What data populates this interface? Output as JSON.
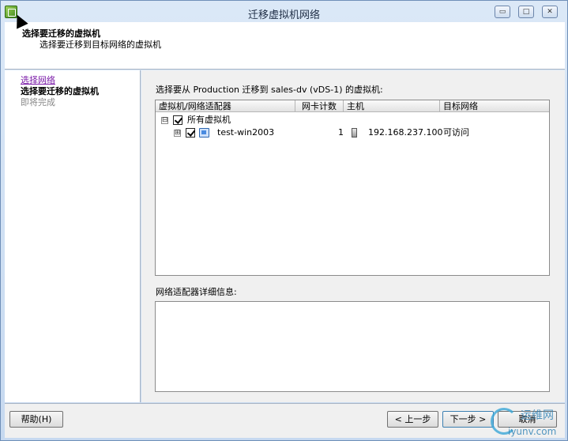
{
  "window": {
    "title": "迁移虚拟机网络",
    "controls": {
      "minimize": "▭",
      "maximize": "□",
      "close": "✕"
    }
  },
  "header": {
    "title": "选择要迁移的虚拟机",
    "subtitle": "选择要迁移到目标网络的虚拟机"
  },
  "nav": {
    "items": [
      {
        "label": "选择网络",
        "state": "link"
      },
      {
        "label": "选择要迁移的虚拟机",
        "state": "current"
      },
      {
        "label": "即将完成",
        "state": "pending"
      }
    ]
  },
  "main": {
    "prompt": "选择要从 Production 迁移到 sales-dv (vDS-1) 的虚拟机:",
    "table": {
      "columns": [
        "虚拟机/网络适配器",
        "网卡计数",
        "主机",
        "目标网络"
      ],
      "group": {
        "expander": "⊟",
        "label": "所有虚拟机",
        "checked": true
      },
      "rows": [
        {
          "expander": "⊞",
          "checked": true,
          "icon": "vm-icon",
          "name": "test-win2003",
          "nic_count": "1",
          "host_icon": "host-icon",
          "host": "192.168.237.100",
          "target": "可访问"
        }
      ]
    },
    "details_label": "网络适配器详细信息:"
  },
  "footer": {
    "help": "帮助(H)",
    "back": "< 上一步",
    "next": "下一步 >",
    "cancel": "取消"
  },
  "watermark": {
    "cn": "运维网",
    "en": "iyunv.com"
  },
  "colors": {
    "link": "#7a1aa8",
    "accent": "#3c7fb1"
  }
}
